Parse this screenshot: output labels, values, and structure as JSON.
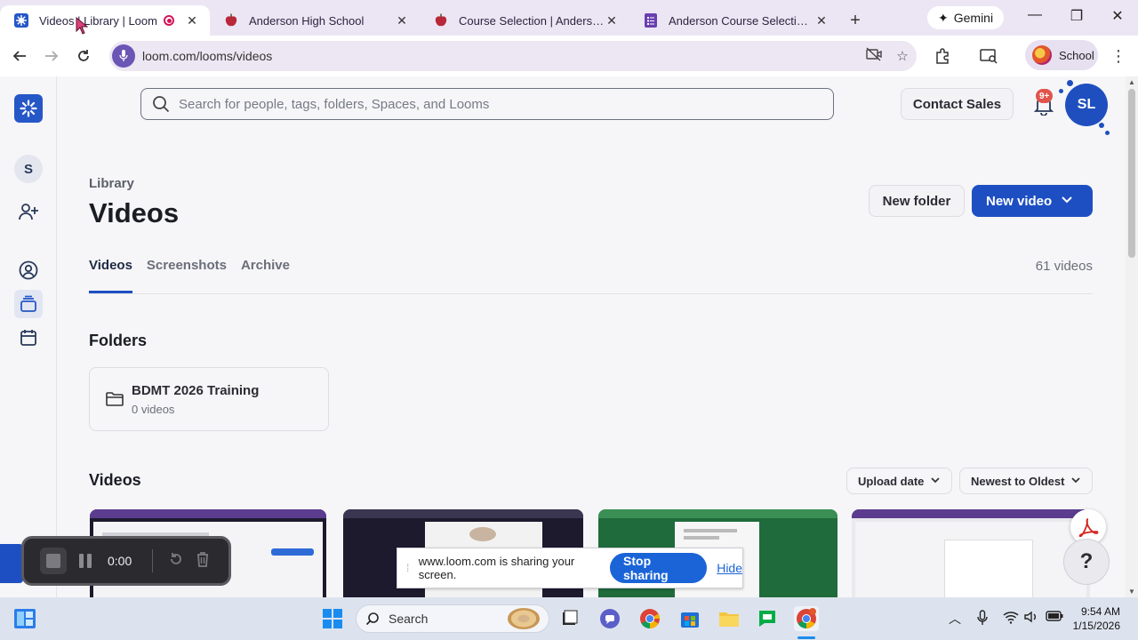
{
  "browser": {
    "tabs": [
      {
        "title": "Videos | Library | Loom",
        "active": true,
        "recording": true
      },
      {
        "title": "Anderson High School",
        "active": false
      },
      {
        "title": "Course Selection | Anderson Hi",
        "active": false
      },
      {
        "title": "Anderson Course Selection For",
        "active": false
      }
    ],
    "gemini_label": "Gemini",
    "url": "loom.com/looms/videos",
    "profile_label": "School"
  },
  "header": {
    "search_placeholder": "Search for people, tags, folders, Spaces, and Looms",
    "contact_sales": "Contact Sales",
    "notif_badge": "9+",
    "user_initials": "SL"
  },
  "sidebar": {
    "workspace_initial": "S"
  },
  "main": {
    "breadcrumb": "Library",
    "title": "Videos",
    "new_folder": "New folder",
    "new_video": "New video",
    "tabs": [
      {
        "label": "Videos",
        "active": true
      },
      {
        "label": "Screenshots",
        "active": false
      },
      {
        "label": "Archive",
        "active": false
      }
    ],
    "video_count": "61 videos",
    "folders_heading": "Folders",
    "folders": [
      {
        "name": "BDMT 2026 Training",
        "count": "0 videos"
      }
    ],
    "videos_heading": "Videos",
    "sort_field": "Upload date",
    "sort_order": "Newest to Oldest"
  },
  "recorder": {
    "time": "0:00"
  },
  "sharing": {
    "message": "www.loom.com is sharing your screen.",
    "stop": "Stop sharing",
    "hide": "Hide"
  },
  "taskbar": {
    "search_label": "Search",
    "time": "9:54 AM",
    "date": "1/15/2026"
  },
  "colors": {
    "primary": "#1e4fc2",
    "tabbar": "#ece6f4",
    "recording": "#d4145a"
  }
}
